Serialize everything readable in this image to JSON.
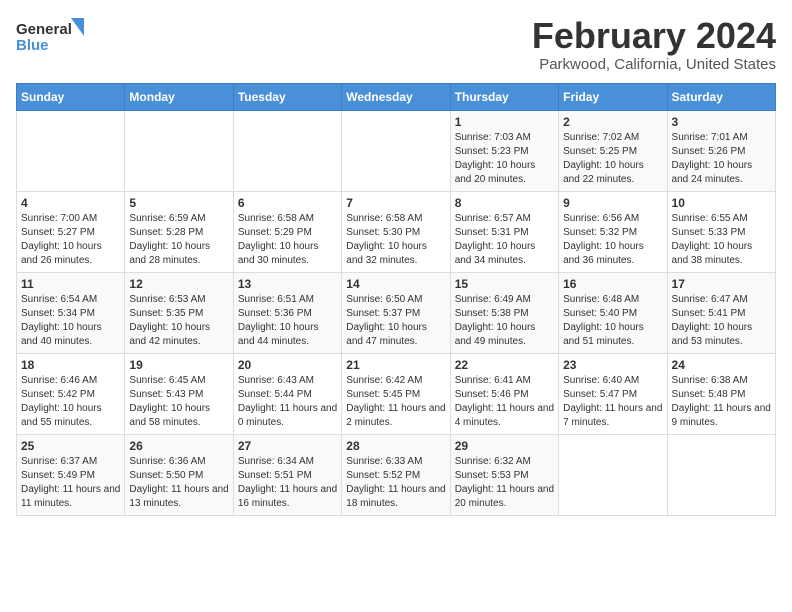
{
  "logo": {
    "line1": "General",
    "line2": "Blue"
  },
  "title": "February 2024",
  "subtitle": "Parkwood, California, United States",
  "days_of_week": [
    "Sunday",
    "Monday",
    "Tuesday",
    "Wednesday",
    "Thursday",
    "Friday",
    "Saturday"
  ],
  "weeks": [
    [
      {
        "day": "",
        "info": ""
      },
      {
        "day": "",
        "info": ""
      },
      {
        "day": "",
        "info": ""
      },
      {
        "day": "",
        "info": ""
      },
      {
        "day": "1",
        "info": "Sunrise: 7:03 AM\nSunset: 5:23 PM\nDaylight: 10 hours\nand 20 minutes."
      },
      {
        "day": "2",
        "info": "Sunrise: 7:02 AM\nSunset: 5:25 PM\nDaylight: 10 hours\nand 22 minutes."
      },
      {
        "day": "3",
        "info": "Sunrise: 7:01 AM\nSunset: 5:26 PM\nDaylight: 10 hours\nand 24 minutes."
      }
    ],
    [
      {
        "day": "4",
        "info": "Sunrise: 7:00 AM\nSunset: 5:27 PM\nDaylight: 10 hours\nand 26 minutes."
      },
      {
        "day": "5",
        "info": "Sunrise: 6:59 AM\nSunset: 5:28 PM\nDaylight: 10 hours\nand 28 minutes."
      },
      {
        "day": "6",
        "info": "Sunrise: 6:58 AM\nSunset: 5:29 PM\nDaylight: 10 hours\nand 30 minutes."
      },
      {
        "day": "7",
        "info": "Sunrise: 6:58 AM\nSunset: 5:30 PM\nDaylight: 10 hours\nand 32 minutes."
      },
      {
        "day": "8",
        "info": "Sunrise: 6:57 AM\nSunset: 5:31 PM\nDaylight: 10 hours\nand 34 minutes."
      },
      {
        "day": "9",
        "info": "Sunrise: 6:56 AM\nSunset: 5:32 PM\nDaylight: 10 hours\nand 36 minutes."
      },
      {
        "day": "10",
        "info": "Sunrise: 6:55 AM\nSunset: 5:33 PM\nDaylight: 10 hours\nand 38 minutes."
      }
    ],
    [
      {
        "day": "11",
        "info": "Sunrise: 6:54 AM\nSunset: 5:34 PM\nDaylight: 10 hours\nand 40 minutes."
      },
      {
        "day": "12",
        "info": "Sunrise: 6:53 AM\nSunset: 5:35 PM\nDaylight: 10 hours\nand 42 minutes."
      },
      {
        "day": "13",
        "info": "Sunrise: 6:51 AM\nSunset: 5:36 PM\nDaylight: 10 hours\nand 44 minutes."
      },
      {
        "day": "14",
        "info": "Sunrise: 6:50 AM\nSunset: 5:37 PM\nDaylight: 10 hours\nand 47 minutes."
      },
      {
        "day": "15",
        "info": "Sunrise: 6:49 AM\nSunset: 5:38 PM\nDaylight: 10 hours\nand 49 minutes."
      },
      {
        "day": "16",
        "info": "Sunrise: 6:48 AM\nSunset: 5:40 PM\nDaylight: 10 hours\nand 51 minutes."
      },
      {
        "day": "17",
        "info": "Sunrise: 6:47 AM\nSunset: 5:41 PM\nDaylight: 10 hours\nand 53 minutes."
      }
    ],
    [
      {
        "day": "18",
        "info": "Sunrise: 6:46 AM\nSunset: 5:42 PM\nDaylight: 10 hours\nand 55 minutes."
      },
      {
        "day": "19",
        "info": "Sunrise: 6:45 AM\nSunset: 5:43 PM\nDaylight: 10 hours\nand 58 minutes."
      },
      {
        "day": "20",
        "info": "Sunrise: 6:43 AM\nSunset: 5:44 PM\nDaylight: 11 hours\nand 0 minutes."
      },
      {
        "day": "21",
        "info": "Sunrise: 6:42 AM\nSunset: 5:45 PM\nDaylight: 11 hours\nand 2 minutes."
      },
      {
        "day": "22",
        "info": "Sunrise: 6:41 AM\nSunset: 5:46 PM\nDaylight: 11 hours\nand 4 minutes."
      },
      {
        "day": "23",
        "info": "Sunrise: 6:40 AM\nSunset: 5:47 PM\nDaylight: 11 hours\nand 7 minutes."
      },
      {
        "day": "24",
        "info": "Sunrise: 6:38 AM\nSunset: 5:48 PM\nDaylight: 11 hours\nand 9 minutes."
      }
    ],
    [
      {
        "day": "25",
        "info": "Sunrise: 6:37 AM\nSunset: 5:49 PM\nDaylight: 11 hours\nand 11 minutes."
      },
      {
        "day": "26",
        "info": "Sunrise: 6:36 AM\nSunset: 5:50 PM\nDaylight: 11 hours\nand 13 minutes."
      },
      {
        "day": "27",
        "info": "Sunrise: 6:34 AM\nSunset: 5:51 PM\nDaylight: 11 hours\nand 16 minutes."
      },
      {
        "day": "28",
        "info": "Sunrise: 6:33 AM\nSunset: 5:52 PM\nDaylight: 11 hours\nand 18 minutes."
      },
      {
        "day": "29",
        "info": "Sunrise: 6:32 AM\nSunset: 5:53 PM\nDaylight: 11 hours\nand 20 minutes."
      },
      {
        "day": "",
        "info": ""
      },
      {
        "day": "",
        "info": ""
      }
    ]
  ]
}
